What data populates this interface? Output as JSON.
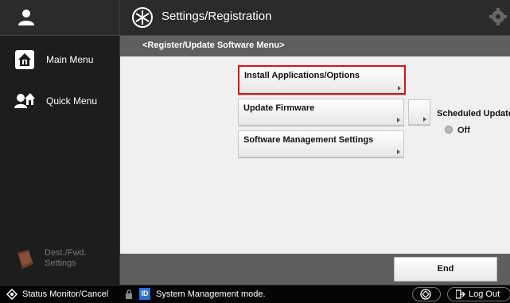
{
  "header": {
    "title": "Settings/Registration",
    "app_icon": "settings-registration-icon",
    "gear_icon": "gear-icon"
  },
  "sidebar": {
    "user_icon": "user-icon",
    "items": [
      {
        "label": "Main Menu",
        "icon": "home-icon"
      },
      {
        "label": "Quick Menu",
        "icon": "quick-menu-icon"
      }
    ],
    "dest_label_line1": "Dest./Fwd.",
    "dest_label_line2": "Settings"
  },
  "breadcrumb": {
    "text": "<Register/Update Software Menu>"
  },
  "menu": {
    "buttons": [
      {
        "label": "Install Applications/Options",
        "selected": true
      },
      {
        "label": "Update Firmware"
      },
      {
        "label": "Software Management Settings"
      }
    ],
    "scheduled_update": {
      "label": "Scheduled Update",
      "status": "Off"
    }
  },
  "footer": {
    "end_label": "End"
  },
  "status_bar": {
    "status_monitor": "Status Monitor/Cancel",
    "id_badge": "ID",
    "mode": "System Management mode.",
    "logout": "Log Out"
  },
  "colors": {
    "selected_border": "#e01010",
    "id_badge": "#2f6fd3"
  }
}
